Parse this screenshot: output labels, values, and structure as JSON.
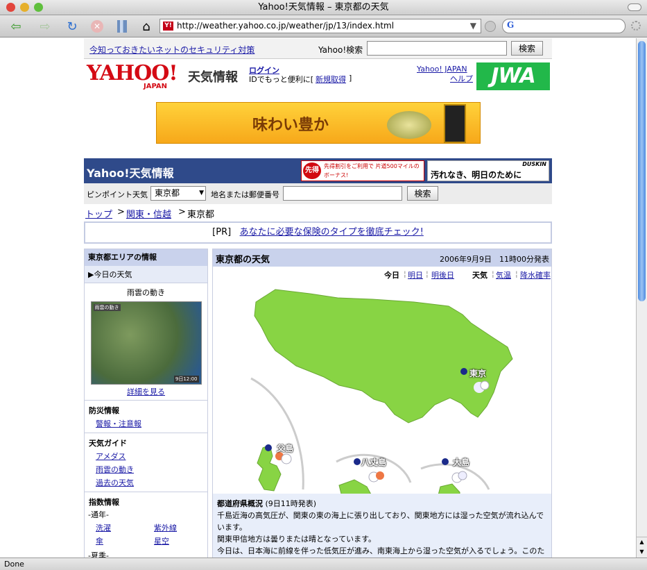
{
  "window": {
    "title": "Yahoo!天気情報 – 東京都の天気"
  },
  "browser": {
    "url": "http://weather.yahoo.co.jp/weather/jp/13/index.html",
    "status": "Done"
  },
  "topbar": {
    "security_link": "今知っておきたいネットのセキュリティ対策",
    "search_label": "Yahoo!検索",
    "search_value": "",
    "search_button": "検索"
  },
  "header": {
    "logo_text": "YAHOO!",
    "logo_sub": "JAPAN",
    "service_name": "天気情報",
    "login_link": "ログイン",
    "login_note": "IDでもっと便利に[",
    "register_link": "新規取得",
    "register_close": "]",
    "yj_link": "Yahoo! JAPAN",
    "help_link": "ヘルプ",
    "jwa_logo": "JWA"
  },
  "banner": {
    "text": "味わい豊か"
  },
  "bluebar": {
    "title": "Yahoo!天気情報",
    "ad1_badge": "先得",
    "ad1_text": "先得割引をご利用で 片道500マイルのボーナス!",
    "ad2_text": "汚れなき、明日のために",
    "ad2_brand": "DUSKIN"
  },
  "searchbar": {
    "pinpoint_label": "ピンポイント天気",
    "pref_selected": "東京都",
    "place_label": "地名または郵便番号",
    "place_value": "",
    "search_button": "検索"
  },
  "breadcrumb": {
    "top": "トップ",
    "sep1": ">",
    "region": "関東・信越",
    "sep2": ">",
    "current": "東京都"
  },
  "pr": {
    "tag": "[PR]",
    "link": "あなたに必要な保険のタイプを徹底チェック!"
  },
  "sidebar": {
    "header": "東京都エリアの情報",
    "today": "▶今日の天気",
    "radar_title": "雨雲の動き",
    "radar_caption": "雨雲の動き",
    "radar_time": "9日12:00",
    "detail_link": "詳細を見る",
    "sections": [
      {
        "title": "防災情報",
        "links": [
          "警報・注意報"
        ]
      },
      {
        "title": "天気ガイド",
        "links": [
          "アメダス",
          "雨雲の動き",
          "過去の天気"
        ]
      }
    ],
    "index_title": "指数情報",
    "index_year": "-通年-",
    "index_links": [
      "洗濯",
      "紫外線",
      "傘",
      "星空"
    ],
    "index_summer": "-夏季-"
  },
  "main": {
    "title": "東京都の天気",
    "issued": "2006年9月9日　11時00分発表",
    "day_tabs": [
      "今日",
      "明日",
      "明後日"
    ],
    "type_tabs": [
      "天気",
      "気温",
      "降水確率"
    ],
    "locations": [
      "東京",
      "父島",
      "八丈島",
      "大島"
    ],
    "overview_title": "都道府県概況",
    "overview_time": "(9日11時発表)",
    "overview_lines": [
      "千島近海の高気圧が、関東の東の海上に張り出しており、関東地方には湿った空気が流れ込んでいます。",
      "関東甲信地方は曇りまたは晴となっています。",
      "今日は、日本海に前線を伴った低気圧が進み、南東海上から湿った空気が入るでしょう。このた"
    ]
  },
  "colors": {
    "bluebar": "#2f4a8a",
    "land": "#88d444",
    "link": "#1a1aa6",
    "side_header": "#c9d2ec"
  }
}
